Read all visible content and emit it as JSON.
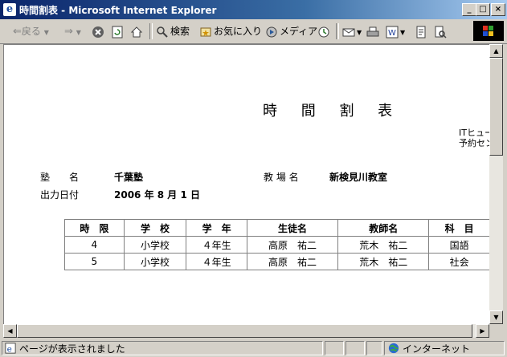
{
  "window": {
    "title": "時間割表 - Microsoft Internet Explorer",
    "controls": [
      "_",
      "□",
      "×"
    ]
  },
  "toolbar": {
    "back": "戻る",
    "search": "検索",
    "favorites": "お気に入り",
    "media": "メディア"
  },
  "document": {
    "title": "時 間 割 表",
    "corp_line1": "ITヒュー",
    "corp_line2": "予約セン",
    "juku_label": "塾　　名",
    "juku_value": "千葉塾",
    "school_label": "教 場 名",
    "school_value": "新検見川教室",
    "date_label": "出力日付",
    "date_value": "2006 年 8 月 1 日",
    "table": {
      "headers": [
        "時　限",
        "学　校",
        "学　年",
        "生徒名",
        "教師名",
        "科　目"
      ],
      "rows": [
        [
          "4",
          "小学校",
          "４年生",
          "高原　祐二",
          "荒木　祐二",
          "国語"
        ],
        [
          "5",
          "小学校",
          "４年生",
          "高原　祐二",
          "荒木　祐二",
          "社会"
        ]
      ]
    }
  },
  "status": {
    "message": "ページが表示されました",
    "zone": "インターネット"
  }
}
